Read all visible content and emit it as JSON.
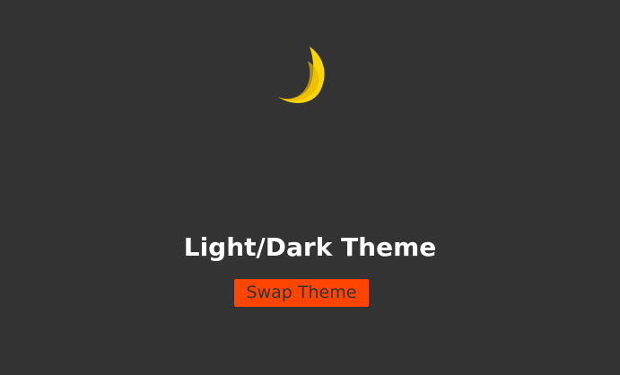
{
  "theme": {
    "background": "#333333",
    "moon_color": "#FFD700",
    "moon_shadow_color": "#E6B800",
    "button_color": "#FF4500",
    "button_text_color": "#333333",
    "title_color": "#FFFFFF"
  },
  "hero": {
    "icon": "moon-icon",
    "title": "Light/Dark Theme"
  },
  "actions": {
    "swap_label": "Swap Theme"
  }
}
